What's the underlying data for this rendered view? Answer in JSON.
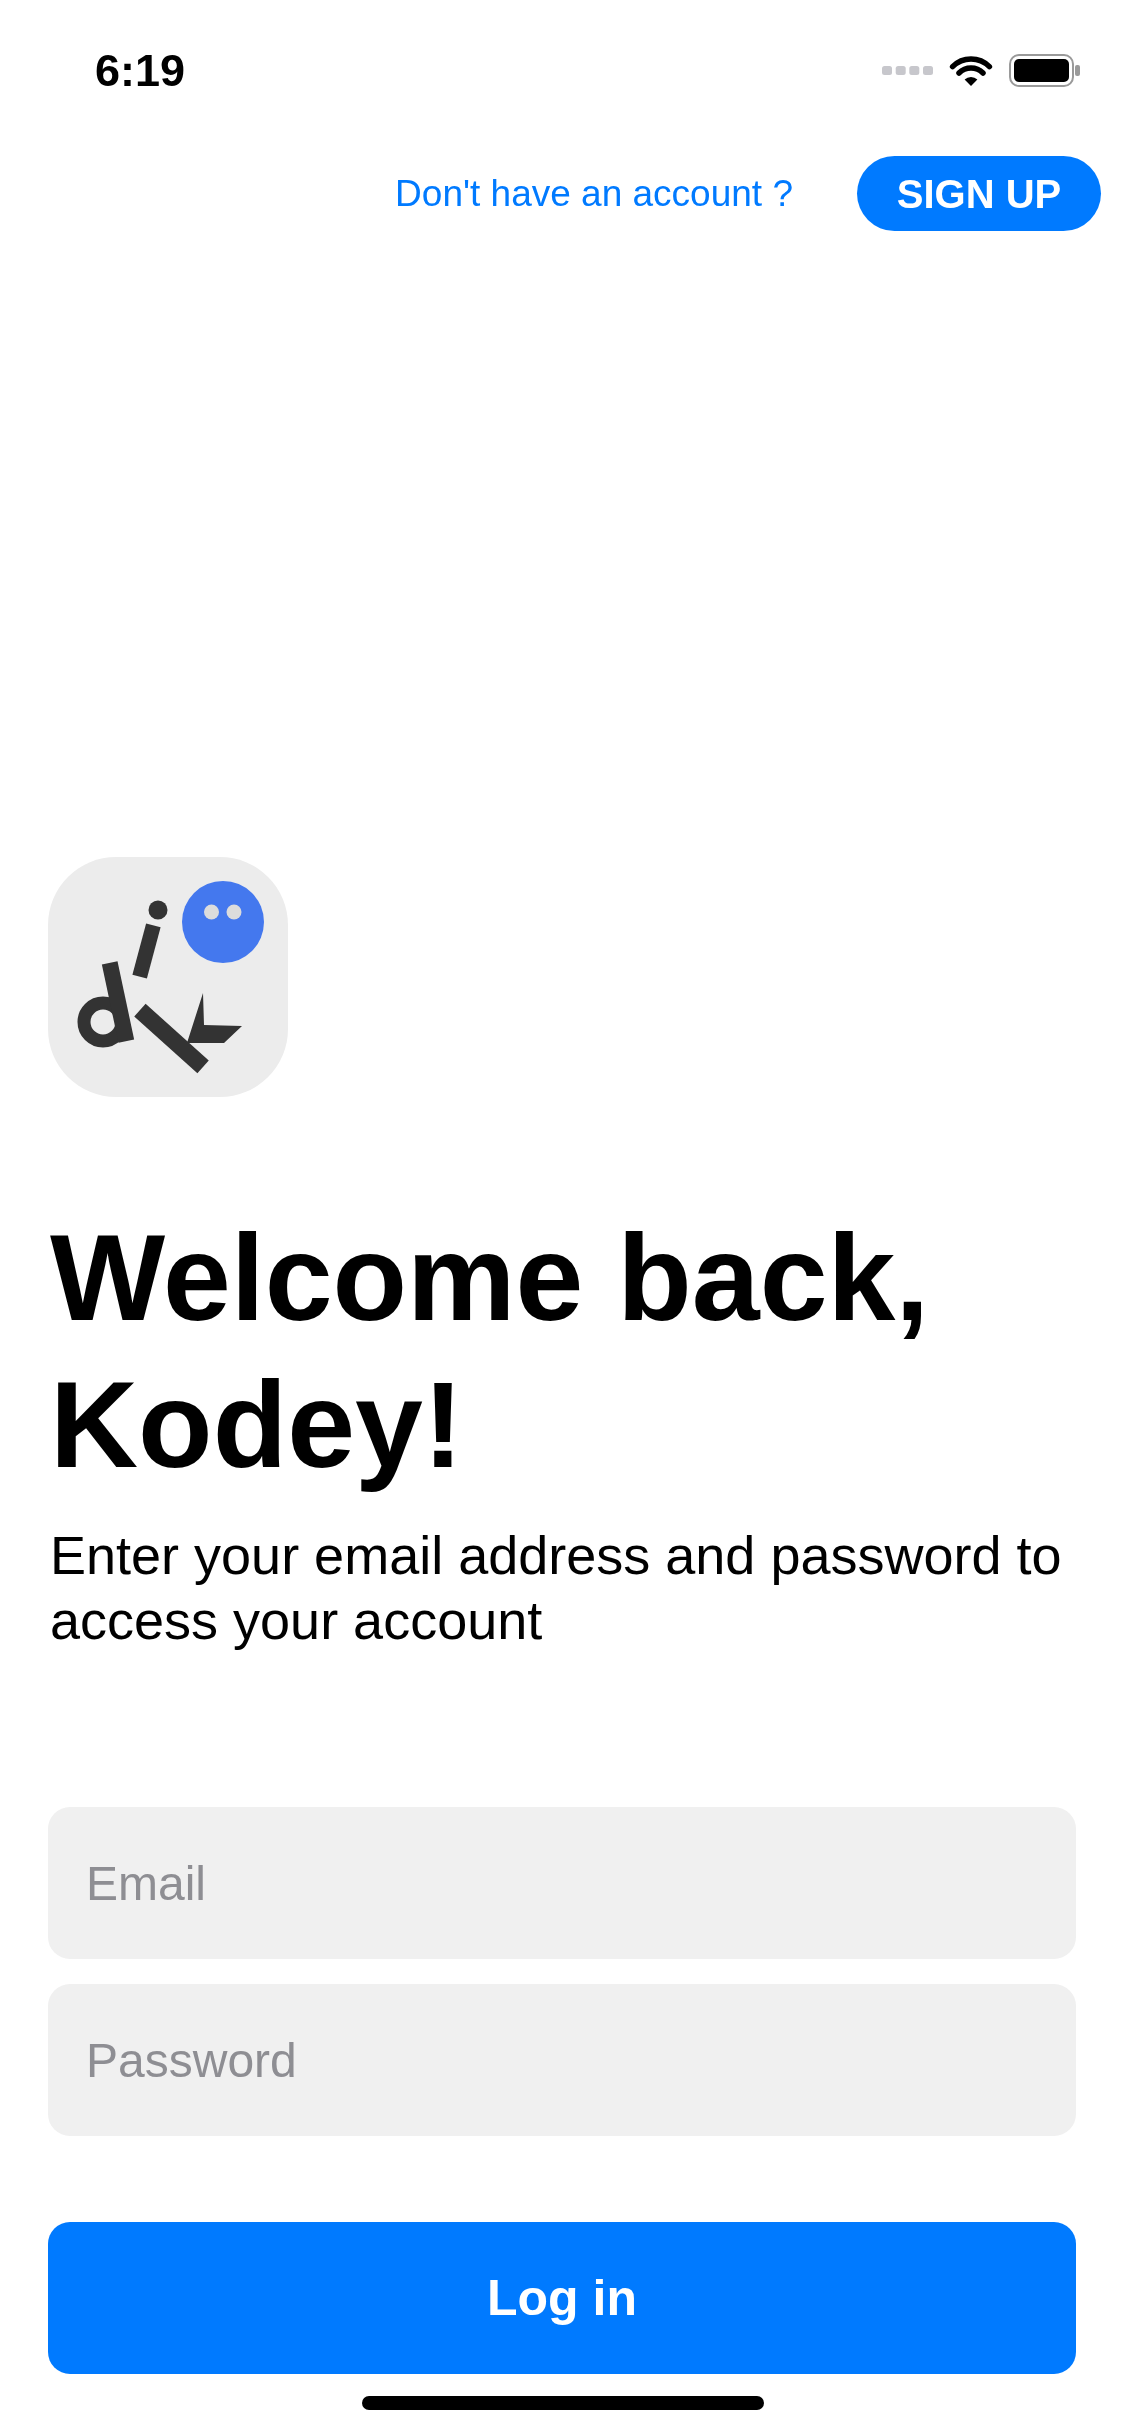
{
  "status_bar": {
    "time": "6:19"
  },
  "header": {
    "prompt": "Don't have an account ?",
    "sign_up_button": "SIGN UP"
  },
  "welcome": {
    "title": "Welcome back, Kodey!",
    "subtitle": "Enter your email address and password to access your account"
  },
  "form": {
    "fields": [
      {
        "placeholder": "Email"
      },
      {
        "placeholder": "Password"
      }
    ],
    "login_button": "Log in"
  }
}
